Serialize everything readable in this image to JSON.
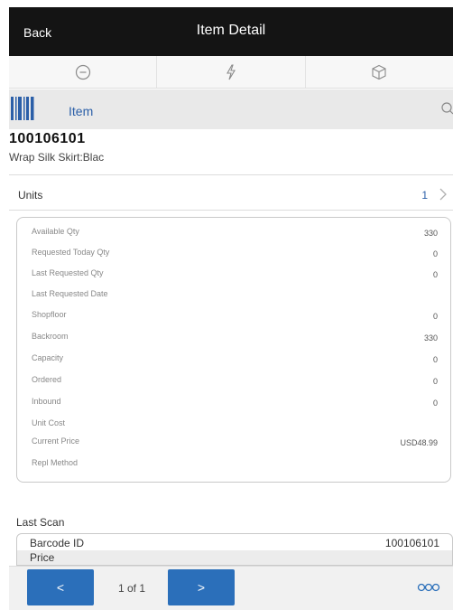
{
  "header": {
    "back_label": "Back",
    "title": "Item Detail"
  },
  "toolbar": {
    "icons": [
      "minus-circle-icon",
      "lightning-icon",
      "cube-icon"
    ]
  },
  "scan": {
    "label": "Item"
  },
  "item": {
    "id": "100106101",
    "description": "Wrap Silk Skirt:Blac"
  },
  "units": {
    "label": "Units",
    "value": "1"
  },
  "details": [
    {
      "label": "Available Qty",
      "value": "330"
    },
    {
      "label": "Requested Today Qty",
      "value": "0"
    },
    {
      "label": "Last Requested Qty",
      "value": "0"
    },
    {
      "label": "Last Requested Date",
      "value": ""
    },
    {
      "label": "Shopfloor",
      "value": "0"
    },
    {
      "label": "Backroom",
      "value": "330"
    },
    {
      "label": "Capacity",
      "value": "0"
    },
    {
      "label": "Ordered",
      "value": "0"
    },
    {
      "label": "Inbound",
      "value": "0"
    },
    {
      "label": "Unit Cost",
      "value": ""
    },
    {
      "label": "Current Price",
      "value": "USD48.99"
    },
    {
      "label": "Repl Method",
      "value": ""
    }
  ],
  "last_scan": {
    "label": "Last Scan",
    "barcode_label": "Barcode ID",
    "barcode_value": "100106101",
    "price_label": "Price"
  },
  "footer": {
    "prev_label": "<",
    "next_label": ">",
    "pager": "1 of 1"
  },
  "colors": {
    "header_bg": "#141414",
    "accent": "#2b6fba",
    "link": "#2b5fa8"
  }
}
